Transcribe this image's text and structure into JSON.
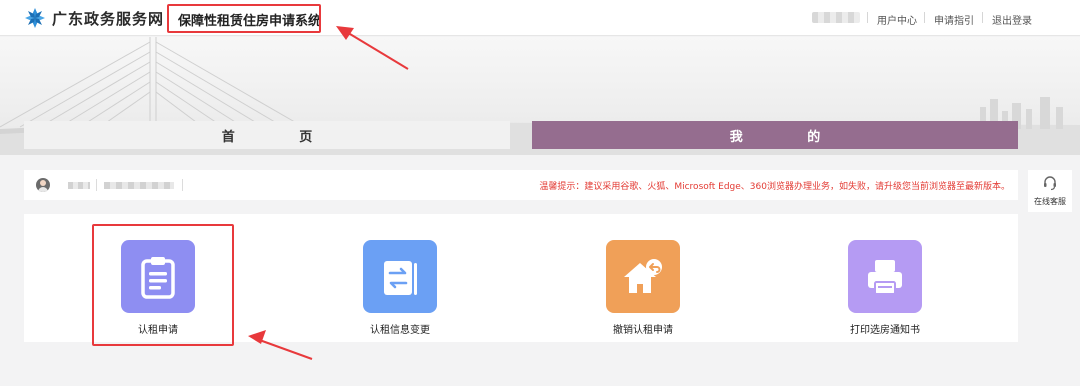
{
  "header": {
    "site_name": "广东政务服务网",
    "system_title": "保障性租赁住房申请系统",
    "links": [
      "用户中心",
      "申请指引",
      "退出登录"
    ]
  },
  "tabs": [
    {
      "label": "首 页",
      "active": false
    },
    {
      "label": "我 的",
      "active": true
    }
  ],
  "info": {
    "notice": "温馨提示：建议采用谷歌、火狐、Microsoft Edge、360浏览器办理业务，如失败，请升级您当前浏览器至最新版本。"
  },
  "online_service": {
    "label": "在线客服",
    "icon": "headset-icon"
  },
  "actions": [
    {
      "label": "认租申请",
      "icon": "clipboard-icon",
      "color": "#8e8ef2"
    },
    {
      "label": "认租信息变更",
      "icon": "exchange-icon",
      "color": "#6ba0f4"
    },
    {
      "label": "撤销认租申请",
      "icon": "home-undo-icon",
      "color": "#f0a058"
    },
    {
      "label": "打印选房通知书",
      "icon": "printer-icon",
      "color": "#b59bf3"
    }
  ],
  "colors": {
    "tab_active": "#956d8f",
    "notice": "#e33b34",
    "annotation": "#e8393c"
  }
}
